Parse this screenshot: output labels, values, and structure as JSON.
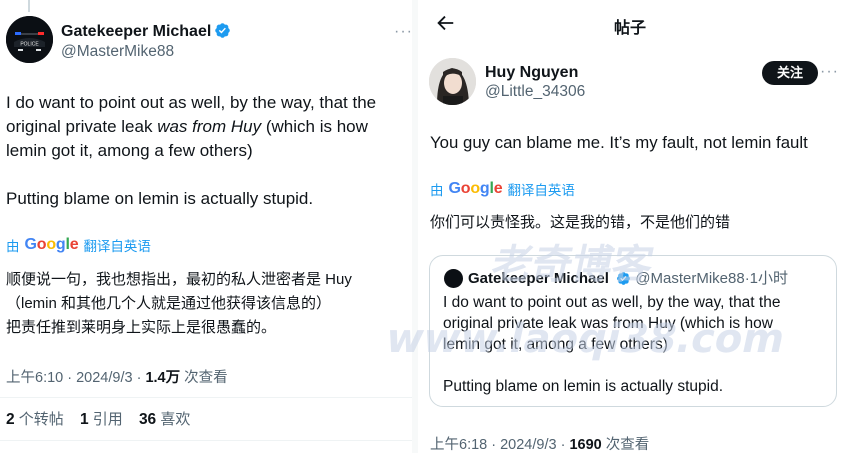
{
  "left_post": {
    "author_name": "Gatekeeper Michael",
    "author_handle": "@MasterMike88",
    "more_icon": "more-dots-icon",
    "avatar_text": "POLICE",
    "text_line1": "I do want to point out as well, by the way, that the",
    "text_line2_pre": "original private leak ",
    "text_line2_italic": "was from Huy",
    "text_line2_post": " (which is how",
    "text_line3": "lemin got it, among a few others)",
    "text_para2": "Putting blame on lemin is actually stupid.",
    "translate_by": "由",
    "translate_label": "翻译自英语",
    "translation_line1": "顺便说一句，我也想指出，最初的私人泄密者是 Huy",
    "translation_line2": "（lemin 和其他几个人就是通过他获得该信息的）",
    "translation_line3": "把责任推到莱明身上实际上是很愚蠢的。",
    "timestamp": "上午6:10 · 2024/9/3 · ",
    "views_count": "1.4万",
    "views_label": " 次查看",
    "reposts_count": "2",
    "reposts_label": " 个转帖",
    "quotes_count": "1",
    "quotes_label": " 引用",
    "likes_count": "36",
    "likes_label": " 喜欢"
  },
  "right_post": {
    "header_title": "帖子",
    "author_name": "Huy Nguyen",
    "author_handle": "@Little_34306",
    "follow_label": "关注",
    "text": "You guy can blame me. It’s my fault, not lemin fault",
    "translate_by": "由",
    "translate_label": "翻译自英语",
    "translation": "你们可以责怪我。这是我的错，不是他们的错",
    "quote": {
      "author_name": "Gatekeeper Michael",
      "author_handle": "@MasterMike88",
      "time": "·1小时",
      "text_line1": "I do want to point out as well, by the way, that the",
      "text_line2": "original private leak was from Huy (which is how",
      "text_line3": "lemin got it, among a few others)",
      "text_para2": "Putting blame on lemin is actually stupid."
    },
    "timestamp": "上午6:18 · 2024/9/3 · ",
    "views_count": "1690",
    "views_label": " 次查看"
  },
  "google": {
    "G": "G",
    "o1": "o",
    "o2": "o",
    "g": "g",
    "l": "l",
    "e": "e"
  },
  "watermark": {
    "line1": "老奇博客",
    "line2": "www.laoqi38.com"
  },
  "colors": {
    "link_blue": "#1d9bf0",
    "verified_blue": "#1d9bf0",
    "text_primary": "#0f1419",
    "text_secondary": "#536471"
  }
}
